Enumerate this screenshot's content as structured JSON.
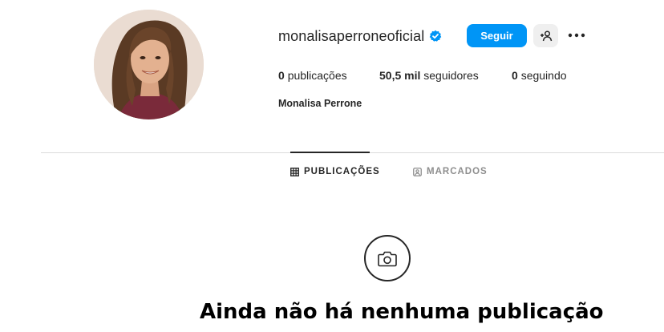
{
  "profile": {
    "username": "monalisaperroneoficial",
    "full_name": "Monalisa Perrone",
    "verified_icon": "verified-badge-icon",
    "follow_label": "Seguir",
    "suggest_icon": "add-person-icon",
    "more_icon": "more-options-icon"
  },
  "stats": {
    "posts_count": "0",
    "posts_label": "publicações",
    "followers_count": "50,5 mil",
    "followers_label": "seguidores",
    "following_count": "0",
    "following_label": "seguindo"
  },
  "tabs": [
    {
      "label": "PUBLICAÇÕES",
      "icon": "grid-icon",
      "active": true
    },
    {
      "label": "MARCADOS",
      "icon": "tagged-icon",
      "active": false
    }
  ],
  "empty_state": {
    "icon": "camera-icon",
    "title": "Ainda não há nenhuma publicação"
  },
  "colors": {
    "primary_button": "#0095f6",
    "verified": "#0095f6",
    "divider": "#dbdbdb",
    "muted_text": "#8e8e8e"
  }
}
